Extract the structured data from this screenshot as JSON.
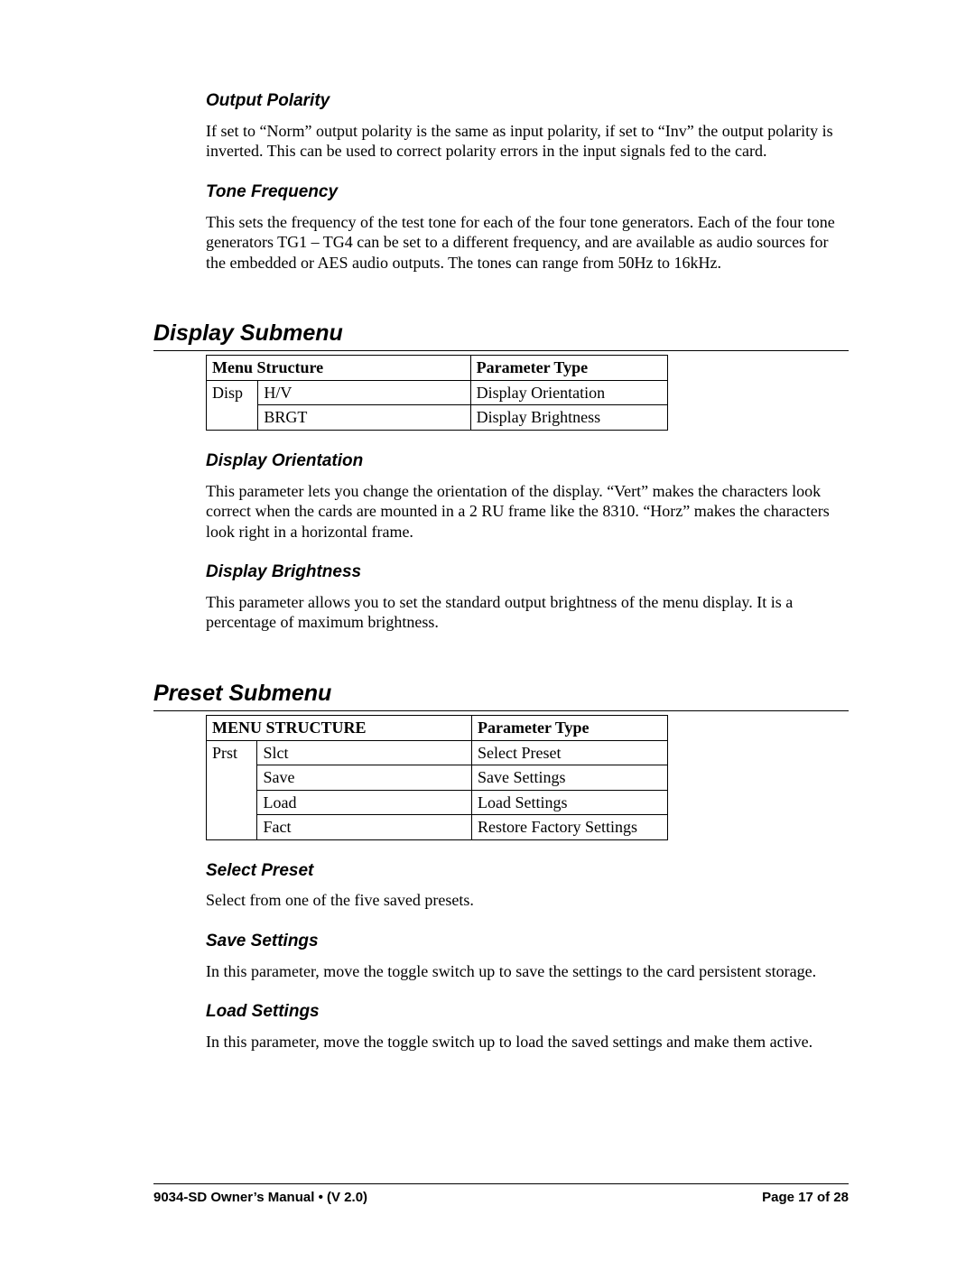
{
  "sections": {
    "output_polarity": {
      "title": "Output Polarity",
      "body": "If set to “Norm” output polarity is the same as input polarity, if set to “Inv” the output polarity is inverted. This can be used to correct polarity errors in the input signals fed to the card."
    },
    "tone_frequency": {
      "title": "Tone Frequency",
      "body": "This sets the frequency of the test tone for each of the four tone generators.  Each of the four tone generators  TG1 – TG4 can be set to a different frequency, and are available as audio sources for the embedded or AES audio outputs. The tones can range from 50Hz to 16kHz."
    },
    "display_submenu": {
      "title": "Display Submenu",
      "table": {
        "headers": [
          "Menu Structure",
          "Parameter Type"
        ],
        "rows": [
          {
            "group": "Disp",
            "item": "H/V",
            "param": "Display Orientation"
          },
          {
            "group": "",
            "item": "BRGT",
            "param": "Display Brightness"
          }
        ]
      },
      "orientation": {
        "title": "Display Orientation",
        "body": "This parameter lets you change the orientation of the display. “Vert” makes the characters look correct when the cards are mounted in a 2 RU frame like the 8310. “Horz” makes the characters look right in a horizontal frame."
      },
      "brightness": {
        "title": "Display Brightness",
        "body": "This parameter allows you to set the standard output brightness of the menu display. It is a percentage of maximum brightness."
      }
    },
    "preset_submenu": {
      "title": "Preset Submenu",
      "table": {
        "headers": [
          "MENU STRUCTURE",
          "Parameter Type"
        ],
        "rows": [
          {
            "group": "Prst",
            "item": "Slct",
            "param": "Select Preset"
          },
          {
            "group": "",
            "item": "Save",
            "param": "Save Settings"
          },
          {
            "group": "",
            "item": "Load",
            "param": "Load Settings"
          },
          {
            "group": "",
            "item": "Fact",
            "param": "Restore Factory Settings"
          }
        ]
      },
      "select_preset": {
        "title": "Select Preset",
        "body": "Select from one of the five saved presets."
      },
      "save_settings": {
        "title": "Save Settings",
        "body": "In this parameter, move the toggle switch up to save the settings to the card persistent storage."
      },
      "load_settings": {
        "title": "Load Settings",
        "body": "In this parameter, move the toggle switch up to load the saved settings and make them active."
      }
    }
  },
  "footer": {
    "left1": "9034-SD Owner’s Manual ",
    "left2": " (V 2.0)",
    "right": "Page 17 of 28"
  }
}
